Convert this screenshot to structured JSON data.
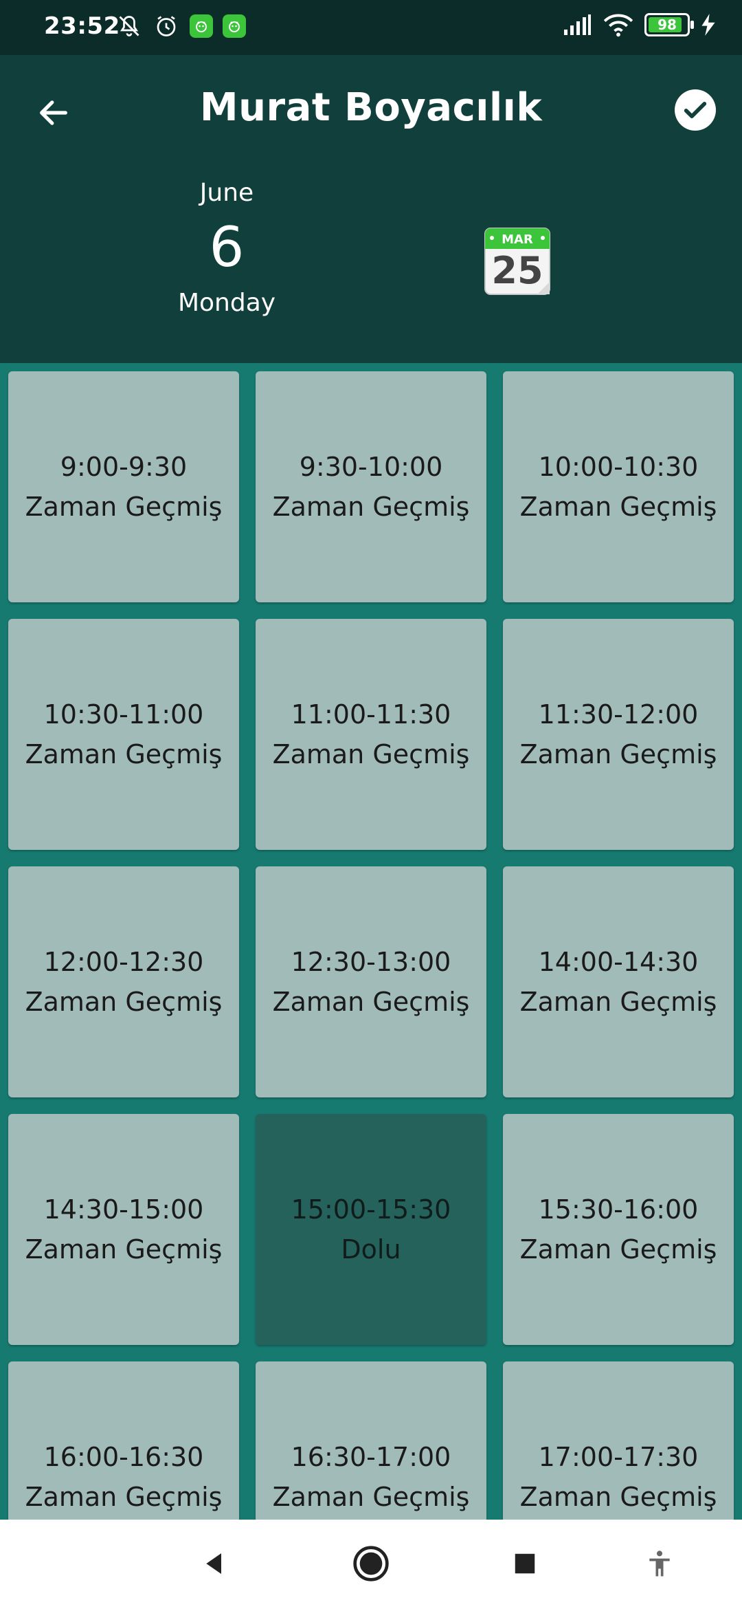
{
  "status_bar": {
    "time": "23:52",
    "battery": "98",
    "icons": [
      "muted-bell-icon",
      "alarm-icon",
      "app-notification-icon",
      "app-notification-icon",
      "signal-icon",
      "wifi-icon",
      "battery-icon",
      "charging-icon"
    ]
  },
  "header": {
    "title": "Murat Boyacılık",
    "month": "June",
    "day": "6",
    "weekday": "Monday",
    "calendar_icon": {
      "month": "MAR",
      "day": "25"
    },
    "colors": {
      "background": "#113f3b",
      "grid": "#177a70",
      "slot": "#a1bcb8",
      "slot_full": "#25625b"
    }
  },
  "slots": [
    {
      "time": "9:00-9:30",
      "status": "Zaman Geçmiş"
    },
    {
      "time": "9:30-10:00",
      "status": "Zaman Geçmiş"
    },
    {
      "time": "10:00-10:30",
      "status": "Zaman Geçmiş"
    },
    {
      "time": "10:30-11:00",
      "status": "Zaman Geçmiş"
    },
    {
      "time": "11:00-11:30",
      "status": "Zaman Geçmiş"
    },
    {
      "time": "11:30-12:00",
      "status": "Zaman Geçmiş"
    },
    {
      "time": "12:00-12:30",
      "status": "Zaman Geçmiş"
    },
    {
      "time": "12:30-13:00",
      "status": "Zaman Geçmiş"
    },
    {
      "time": "14:00-14:30",
      "status": "Zaman Geçmiş"
    },
    {
      "time": "14:30-15:00",
      "status": "Zaman Geçmiş"
    },
    {
      "time": "15:00-15:30",
      "status": "Dolu"
    },
    {
      "time": "15:30-16:00",
      "status": "Zaman Geçmiş"
    },
    {
      "time": "16:00-16:30",
      "status": "Zaman Geçmiş"
    },
    {
      "time": "16:30-17:00",
      "status": "Zaman Geçmiş"
    },
    {
      "time": "17:00-17:30",
      "status": "Zaman Geçmiş"
    }
  ],
  "nav_bar": {
    "items": [
      "back-nav-icon",
      "home-nav-icon",
      "recents-nav-icon",
      "accessibility-icon"
    ]
  }
}
